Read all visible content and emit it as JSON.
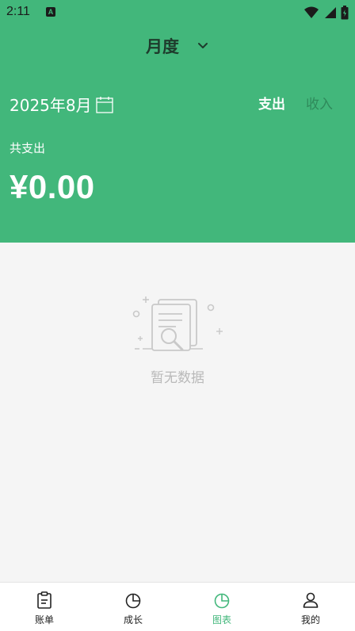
{
  "status_bar": {
    "time": "2:11",
    "notification_badge": "A",
    "icons": [
      "wifi-icon",
      "signal-icon",
      "battery-icon"
    ]
  },
  "period_selector": {
    "label": "月度",
    "icon": "chevron-down-icon"
  },
  "month": {
    "text": "2025年8月",
    "icon": "calendar-icon"
  },
  "type_tabs": [
    {
      "label": "支出",
      "active": true
    },
    {
      "label": "收入",
      "active": false
    }
  ],
  "summary": {
    "label": "共支出",
    "amount": "¥0.00"
  },
  "empty_state": {
    "text": "暂无数据",
    "icon": "empty-document-search-icon"
  },
  "tabbar": [
    {
      "label": "账单",
      "icon": "clipboard-icon",
      "active": false
    },
    {
      "label": "成长",
      "icon": "pie-chart-icon",
      "active": false
    },
    {
      "label": "图表",
      "icon": "chart-icon",
      "active": true
    },
    {
      "label": "我的",
      "icon": "user-icon",
      "active": false
    }
  ],
  "colors": {
    "primary": "#42b77b",
    "inactive_tab": "#2f8a5b",
    "background": "#f5f5f5",
    "empty_text": "#b9b9b9"
  }
}
